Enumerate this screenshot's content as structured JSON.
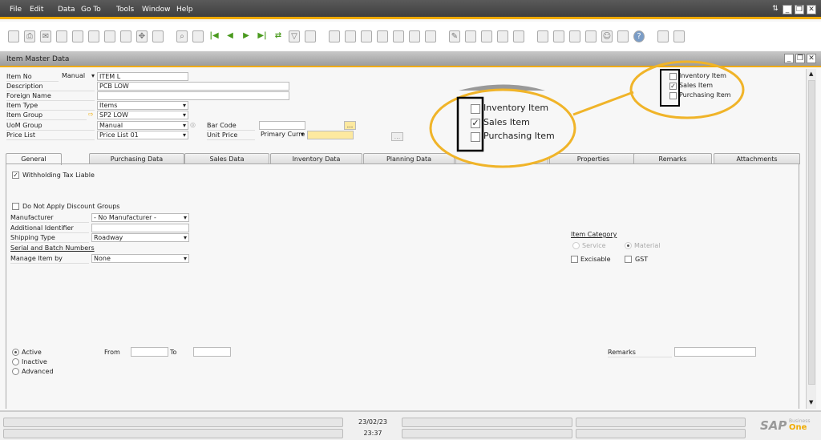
{
  "menu": [
    "File",
    "Edit",
    "Data",
    "Go To",
    "Tools",
    "Window",
    "Help"
  ],
  "toolbar_icons": [
    "preview-icon",
    "print-icon",
    "email-icon",
    "export-icon",
    "fax-icon",
    "excel-icon",
    "word-icon",
    "pdf-icon",
    "move-icon",
    "settings-icon",
    "|",
    "find-icon",
    "list-icon",
    "first-record-icon",
    "previous-record-icon",
    "next-record-icon",
    "last-record-icon",
    "refresh-icon",
    "filter-icon",
    "sort-icon",
    "|",
    "copy-icon",
    "paste-icon",
    "calc-icon",
    "drill-icon",
    "chart-icon",
    "gantt-icon",
    "inspect-icon",
    "|",
    "edit-icon",
    "new-doc-icon",
    "form-settings-icon",
    "message-icon",
    "reply-icon",
    "|",
    "checklist-icon",
    "mail-icon",
    "calendar-icon",
    "org-icon",
    "user-icon",
    "web-icon",
    "help-icon",
    "|",
    "doc-a-icon",
    "doc-b-icon"
  ],
  "form": {
    "title": "Item Master Data",
    "item_no_label": "Item No",
    "item_no_series": "Manual",
    "item_no": "ITEM L",
    "description_label": "Description",
    "description": "PCB LOW",
    "foreign_name_label": "Foreign Name",
    "foreign_name": "",
    "item_type_label": "Item Type",
    "item_type": "Items",
    "item_group_label": "Item Group",
    "item_group": "SP2 LOW",
    "uom_group_label": "UoM Group",
    "uom_group": "Manual",
    "price_list_label": "Price List",
    "price_list": "Price List 01",
    "bar_code_label": "Bar Code",
    "bar_code": "",
    "unit_price_label": "Unit Price",
    "currency": "Primary Curre",
    "unit_price": "",
    "ellipsis": "...",
    "inventory_item": "Inventory Item",
    "sales_item": "Sales Item",
    "purchasing_item": "Purchasing Item",
    "inventory_checked": false,
    "sales_checked": true,
    "purchasing_checked": false
  },
  "tabs": [
    "General",
    "Purchasing Data",
    "Sales Data",
    "Inventory Data",
    "Planning Data",
    "Production Data",
    "Properties",
    "Remarks",
    "Attachments"
  ],
  "general": {
    "withholding": "Withholding Tax Liable",
    "no_discount": "Do Not Apply Discount Groups",
    "manufacturer_label": "Manufacturer",
    "manufacturer": "- No Manufacturer -",
    "additional_id_label": "Additional Identifier",
    "additional_id": "",
    "shipping_label": "Shipping Type",
    "shipping": "Roadway",
    "serial_link": "Serial and Batch Numbers",
    "manage_label": "Manage Item by",
    "manage": "None",
    "category_title": "Item Category",
    "service": "Service",
    "material": "Material",
    "excisable": "Excisable",
    "gst": "GST",
    "active": "Active",
    "inactive": "Inactive",
    "advanced": "Advanced",
    "from": "From",
    "to": "To",
    "remarks": "Remarks"
  },
  "status": {
    "date": "23/02/23",
    "time": "23:37",
    "logo": "SAP Business One"
  },
  "callout": {
    "inventory": "Inventory Item",
    "sales": "Sales Item",
    "purchasing": "Purchasing Item"
  },
  "colors": {
    "accent": "#f0ab00",
    "menubar": "#4a4a4a"
  }
}
